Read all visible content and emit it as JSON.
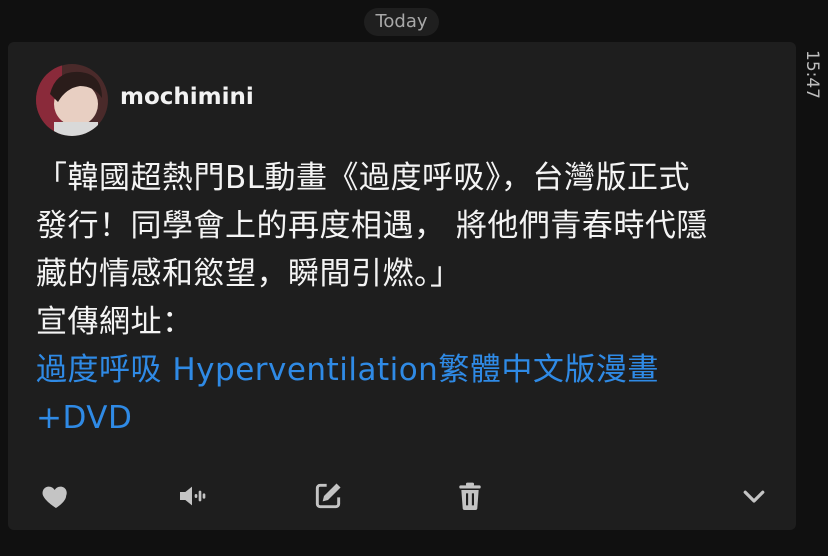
{
  "header": {
    "date_label": "Today"
  },
  "sidebar": {
    "time": "15:47"
  },
  "message": {
    "author": "mochimini",
    "lines": [
      "「韓國超熱門BL動畫《過度呼吸》，台灣版正式",
      "發行！同學會上的再度相遇， 將他們青春時代隱",
      "藏的情感和慾望，瞬間引燃。」",
      "宣傳網址："
    ],
    "link_lines": [
      "過度呼吸 Hyperventilation繁體中文版漫畫",
      "+DVD"
    ]
  },
  "actions": [
    {
      "name": "heart-icon"
    },
    {
      "name": "speaker-icon"
    },
    {
      "name": "edit-icon"
    },
    {
      "name": "trash-icon"
    },
    {
      "name": "chevron-down-icon"
    }
  ],
  "colors": {
    "background": "#101010",
    "card": "#1e1e1e",
    "text": "#f4f4f4",
    "link": "#2f8ae5",
    "icon": "#c4c4c4"
  }
}
